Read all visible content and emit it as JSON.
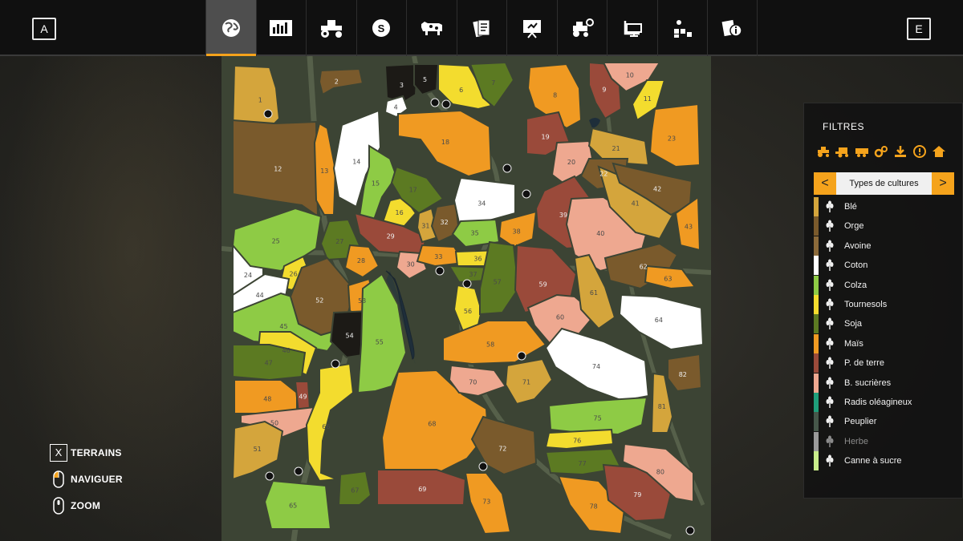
{
  "topbar": {
    "left_key": "A",
    "right_key": "E",
    "tabs": [
      {
        "icon": "globe-icon",
        "active": true
      },
      {
        "icon": "stats-chart-icon",
        "active": false
      },
      {
        "icon": "tractor-icon",
        "active": false
      },
      {
        "icon": "dollar-coin-icon",
        "active": false
      },
      {
        "icon": "cow-icon",
        "active": false
      },
      {
        "icon": "contracts-icon",
        "active": false
      },
      {
        "icon": "presentation-board-icon",
        "active": false
      },
      {
        "icon": "vehicle-settings-icon",
        "active": false
      },
      {
        "icon": "monitor-icon",
        "active": false
      },
      {
        "icon": "production-icon",
        "active": false
      },
      {
        "icon": "info-cards-icon",
        "active": false
      }
    ]
  },
  "filters": {
    "title": "FILTRES",
    "icons": [
      "tractor-filter-icon",
      "harvester-filter-icon",
      "trailer-filter-icon",
      "gears-filter-icon",
      "download-filter-icon",
      "warning-filter-icon",
      "home-filter-icon"
    ],
    "selector": {
      "prev": "<",
      "value": "Types de cultures",
      "next": ">"
    },
    "crops": [
      {
        "label": "Blé",
        "color": "#d4a53c",
        "icon": "wheat-icon"
      },
      {
        "label": "Orge",
        "color": "#7a5a2c",
        "icon": "barley-icon"
      },
      {
        "label": "Avoine",
        "color": "#8b6a3a",
        "icon": "oat-icon"
      },
      {
        "label": "Coton",
        "color": "#ffffff",
        "icon": "cotton-icon"
      },
      {
        "label": "Colza",
        "color": "#8ecb45",
        "icon": "canola-icon"
      },
      {
        "label": "Tournesols",
        "color": "#f3dc2e",
        "icon": "sunflower-icon"
      },
      {
        "label": "Soja",
        "color": "#5c7a22",
        "icon": "soybean-icon"
      },
      {
        "label": "Maïs",
        "color": "#f09a22",
        "icon": "corn-icon"
      },
      {
        "label": "P. de terre",
        "color": "#9a4a3a",
        "icon": "potato-icon"
      },
      {
        "label": "B. sucrières",
        "color": "#eea890",
        "icon": "sugarbeet-icon"
      },
      {
        "label": "Radis oléagineux",
        "color": "#1f9e7a",
        "icon": "radish-icon"
      },
      {
        "label": "Peuplier",
        "color": "#46574a",
        "icon": "poplar-icon"
      },
      {
        "label": "Herbe",
        "color": "#9a9a9a",
        "icon": "grass-icon",
        "dimmed": true
      },
      {
        "label": "Canne à sucre",
        "color": "#c8ec8a",
        "icon": "sugarcane-icon"
      }
    ]
  },
  "controls": [
    {
      "key": "X",
      "label": "TERRAINS",
      "icon": "x-key-icon"
    },
    {
      "key": "",
      "label": "NAVIGUER",
      "icon": "mouse-left-icon"
    },
    {
      "key": "",
      "label": "ZOOM",
      "icon": "mouse-wheel-icon"
    }
  ],
  "map": {
    "fields": [
      {
        "id": "1",
        "crop": "Blé"
      },
      {
        "id": "2",
        "crop": "Orge"
      },
      {
        "id": "3",
        "crop": "dark"
      },
      {
        "id": "4",
        "crop": "Coton"
      },
      {
        "id": "5",
        "crop": "dark"
      },
      {
        "id": "6",
        "crop": "Tournesols"
      },
      {
        "id": "7",
        "crop": "Soja"
      },
      {
        "id": "8",
        "crop": "Maïs"
      },
      {
        "id": "9",
        "crop": "P. de terre"
      },
      {
        "id": "10",
        "crop": "B. sucrières"
      },
      {
        "id": "11",
        "crop": "Tournesols"
      },
      {
        "id": "12",
        "crop": "Orge"
      },
      {
        "id": "13",
        "crop": "Maïs"
      },
      {
        "id": "14",
        "crop": "Coton"
      },
      {
        "id": "15",
        "crop": "Colza"
      },
      {
        "id": "16",
        "crop": "Tournesols"
      },
      {
        "id": "17",
        "crop": "Soja"
      },
      {
        "id": "18",
        "crop": "Maïs"
      },
      {
        "id": "19",
        "crop": "P. de terre"
      },
      {
        "id": "20",
        "crop": "B. sucrières"
      },
      {
        "id": "21",
        "crop": "Blé"
      },
      {
        "id": "22",
        "crop": "Orge"
      },
      {
        "id": "23",
        "crop": "Maïs"
      },
      {
        "id": "24",
        "crop": "Coton"
      },
      {
        "id": "25",
        "crop": "Colza"
      },
      {
        "id": "26",
        "crop": "Tournesols"
      },
      {
        "id": "27",
        "crop": "Soja"
      },
      {
        "id": "28",
        "crop": "Maïs"
      },
      {
        "id": "29",
        "crop": "P. de terre"
      },
      {
        "id": "30",
        "crop": "B. sucrières"
      },
      {
        "id": "31",
        "crop": "Blé"
      },
      {
        "id": "32",
        "crop": "Orge"
      },
      {
        "id": "33",
        "crop": "Maïs"
      },
      {
        "id": "34",
        "crop": "Coton"
      },
      {
        "id": "35",
        "crop": "Colza"
      },
      {
        "id": "36",
        "crop": "Tournesols"
      },
      {
        "id": "37",
        "crop": "Soja"
      },
      {
        "id": "38",
        "crop": "Maïs"
      },
      {
        "id": "39",
        "crop": "P. de terre"
      },
      {
        "id": "40",
        "crop": "B. sucrières"
      },
      {
        "id": "41",
        "crop": "Blé"
      },
      {
        "id": "42",
        "crop": "Orge"
      },
      {
        "id": "43",
        "crop": "Maïs"
      },
      {
        "id": "44",
        "crop": "Coton"
      },
      {
        "id": "45",
        "crop": "Colza"
      },
      {
        "id": "46",
        "crop": "Tournesols"
      },
      {
        "id": "47",
        "crop": "Soja"
      },
      {
        "id": "48",
        "crop": "Maïs"
      },
      {
        "id": "49",
        "crop": "P. de terre"
      },
      {
        "id": "50",
        "crop": "B. sucrières"
      },
      {
        "id": "51",
        "crop": "Blé"
      },
      {
        "id": "52",
        "crop": "Orge"
      },
      {
        "id": "53",
        "crop": "Maïs"
      },
      {
        "id": "54",
        "crop": "dark"
      },
      {
        "id": "55",
        "crop": "Colza"
      },
      {
        "id": "56",
        "crop": "Tournesols"
      },
      {
        "id": "57",
        "crop": "Soja"
      },
      {
        "id": "58",
        "crop": "Maïs"
      },
      {
        "id": "59",
        "crop": "P. de terre"
      },
      {
        "id": "60",
        "crop": "B. sucrières"
      },
      {
        "id": "61",
        "crop": "Blé"
      },
      {
        "id": "62",
        "crop": "Orge"
      },
      {
        "id": "63",
        "crop": "Maïs"
      },
      {
        "id": "64",
        "crop": "Coton"
      },
      {
        "id": "65",
        "crop": "Colza"
      },
      {
        "id": "66",
        "crop": "Tournesols"
      },
      {
        "id": "67",
        "crop": "Soja"
      },
      {
        "id": "68",
        "crop": "Maïs"
      },
      {
        "id": "69",
        "crop": "P. de terre"
      },
      {
        "id": "70",
        "crop": "B. sucrières"
      },
      {
        "id": "71",
        "crop": "Blé"
      },
      {
        "id": "72",
        "crop": "Orge"
      },
      {
        "id": "73",
        "crop": "Maïs"
      },
      {
        "id": "74",
        "crop": "Coton"
      },
      {
        "id": "75",
        "crop": "Colza"
      },
      {
        "id": "76",
        "crop": "Tournesols"
      },
      {
        "id": "77",
        "crop": "Soja"
      },
      {
        "id": "78",
        "crop": "Maïs"
      },
      {
        "id": "79",
        "crop": "P. de terre"
      },
      {
        "id": "80",
        "crop": "B. sucrières"
      },
      {
        "id": "81",
        "crop": "Blé"
      },
      {
        "id": "82",
        "crop": "Orge"
      }
    ]
  }
}
